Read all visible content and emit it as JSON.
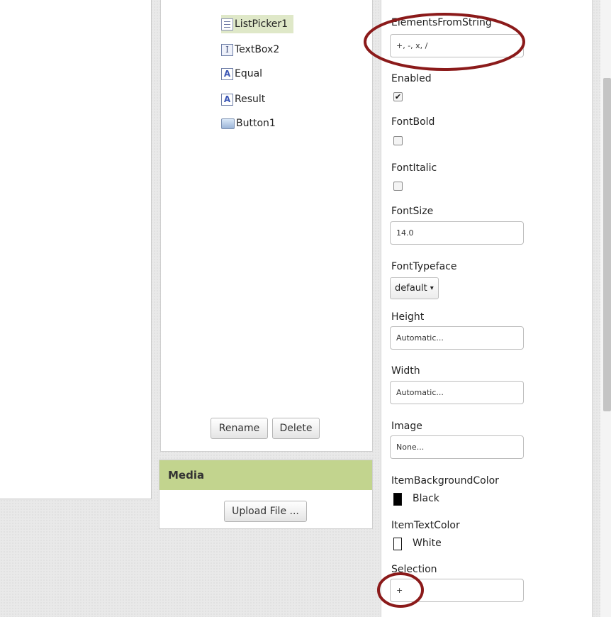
{
  "components": {
    "items": [
      {
        "label": "ListPicker1",
        "icon": "listpicker-icon",
        "selected": true
      },
      {
        "label": "TextBox2",
        "icon": "textbox-icon",
        "selected": false
      },
      {
        "label": "Equal",
        "icon": "label-icon",
        "selected": false
      },
      {
        "label": "Result",
        "icon": "label-icon",
        "selected": false
      },
      {
        "label": "Button1",
        "icon": "button-icon",
        "selected": false
      }
    ],
    "rename_label": "Rename",
    "delete_label": "Delete"
  },
  "media": {
    "header": "Media",
    "upload_label": "Upload File ..."
  },
  "properties": {
    "elements_from_string": {
      "label": "ElementsFromString",
      "value": "+, -, x, /"
    },
    "enabled": {
      "label": "Enabled",
      "checked": true
    },
    "font_bold": {
      "label": "FontBold",
      "checked": false
    },
    "font_italic": {
      "label": "FontItalic",
      "checked": false
    },
    "font_size": {
      "label": "FontSize",
      "value": "14.0"
    },
    "font_typeface": {
      "label": "FontTypeface",
      "value": "default",
      "caret": "▾"
    },
    "height": {
      "label": "Height",
      "value": "Automatic..."
    },
    "width": {
      "label": "Width",
      "value": "Automatic..."
    },
    "image": {
      "label": "Image",
      "value": "None..."
    },
    "item_background_color": {
      "label": "ItemBackgroundColor",
      "value": "Black",
      "swatch": "#000000"
    },
    "item_text_color": {
      "label": "ItemTextColor",
      "value": "White",
      "swatch": "#ffffff"
    },
    "selection": {
      "label": "Selection",
      "value": "+"
    }
  },
  "colors": {
    "selected_row": "#dfe8c8",
    "media_header": "#c2d48e",
    "annotation": "#8b1a1a"
  }
}
